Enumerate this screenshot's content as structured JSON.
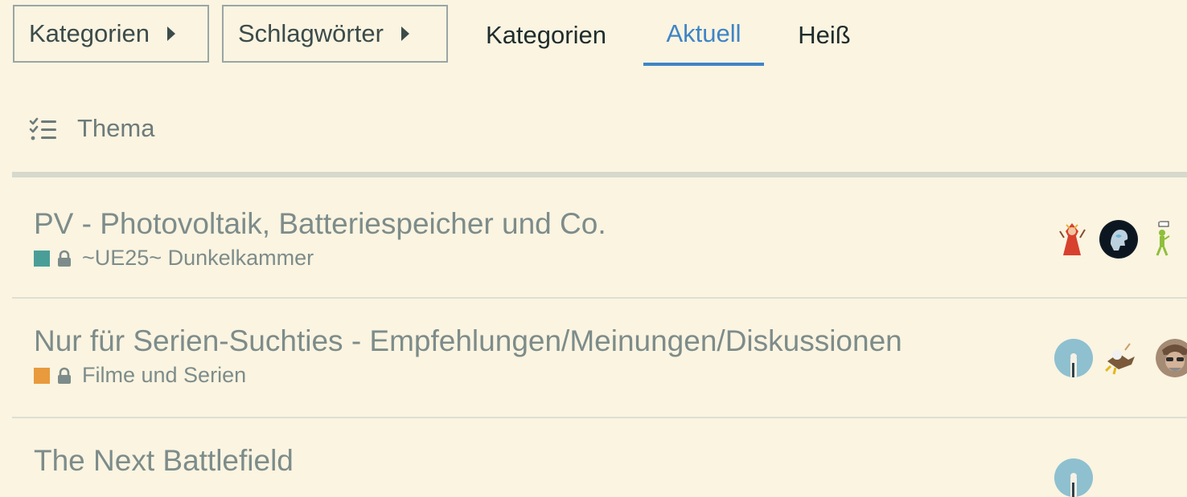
{
  "nav": {
    "dropdowns": [
      {
        "label": "Kategorien"
      },
      {
        "label": "Schlagwörter"
      }
    ],
    "tabs": [
      {
        "label": "Kategorien",
        "active": false
      },
      {
        "label": "Aktuell",
        "active": true
      },
      {
        "label": "Heiß",
        "active": false
      }
    ]
  },
  "list_header": {
    "label": "Thema",
    "icon": "checklist-icon"
  },
  "topics": [
    {
      "title": "PV - Photovoltaik, Batteriespeicher und Co.",
      "category": "~UE25~ Dunkelkammer",
      "category_color": "#4a9e98",
      "locked": true
    },
    {
      "title": "Nur für Serien-Suchties - Empfehlungen/Meinungen/Diskussionen",
      "category": "Filme und Serien",
      "category_color": "#e89a3c",
      "locked": true
    },
    {
      "title": "The Next Battlefield"
    }
  ],
  "colors": {
    "background": "#faf4e1",
    "accent": "#3f84c6"
  }
}
